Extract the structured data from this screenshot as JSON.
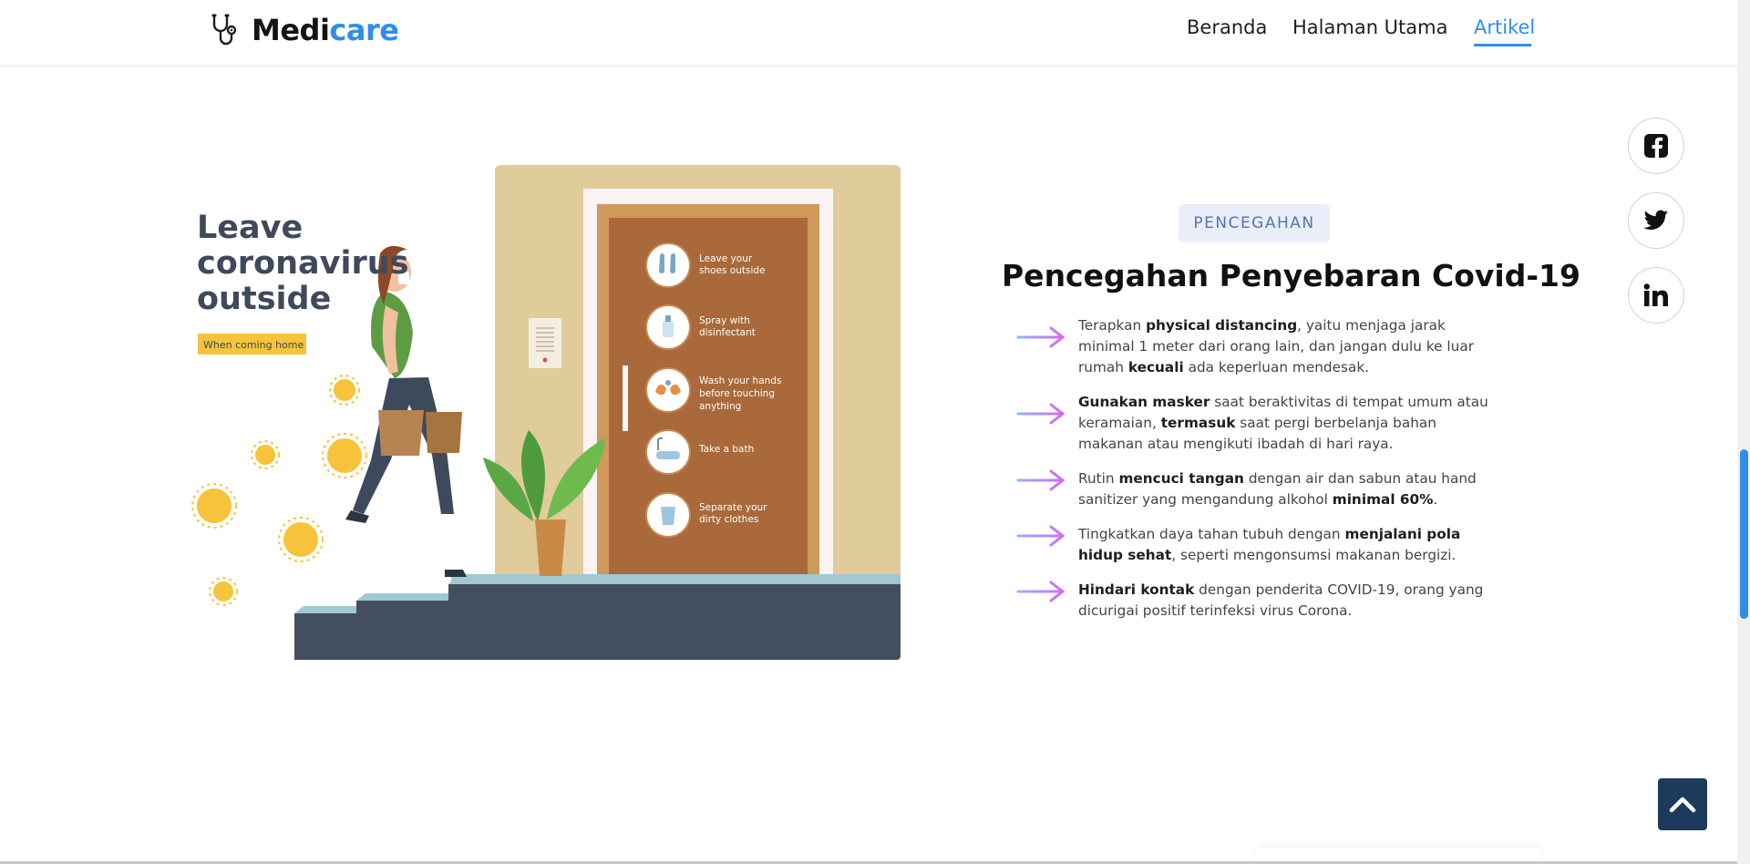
{
  "brand": {
    "part1": "Medi",
    "part2": "care"
  },
  "nav": {
    "items": [
      {
        "label": "Beranda"
      },
      {
        "label": "Halaman Utama"
      },
      {
        "label": "Artikel",
        "active": true
      }
    ]
  },
  "illustration": {
    "headline_1": "Leave",
    "headline_2": "coronavirus",
    "headline_3": "outside",
    "badge": "When coming home",
    "steps": [
      {
        "line1": "Leave your",
        "line2": "shoes outside",
        "line3": ""
      },
      {
        "line1": "Spray with",
        "line2": "disinfectant",
        "line3": ""
      },
      {
        "line1": "Wash your hands",
        "line2": "before touching",
        "line3": "anything"
      },
      {
        "line1": "Take a bath",
        "line2": "",
        "line3": ""
      },
      {
        "line1": "Separate your",
        "line2": "dirty clothes",
        "line3": ""
      }
    ]
  },
  "article": {
    "tag": "PENCEGAHAN",
    "title": "Pencegahan Penyebaran Covid-19",
    "items": [
      {
        "parts": [
          "Terapkan ",
          "physical distancing",
          ", yaitu menjaga jarak minimal 1 meter dari orang lain, dan jangan dulu ke luar rumah ",
          "kecuali",
          " ada keperluan mendesak."
        ]
      },
      {
        "parts": [
          "",
          "Gunakan masker",
          " saat beraktivitas di tempat umum atau keramaian, ",
          "termasuk",
          " saat pergi berbelanja bahan makanan atau mengikuti ibadah di hari raya."
        ]
      },
      {
        "parts": [
          "Rutin ",
          "mencuci tangan",
          " dengan air dan sabun atau hand sanitizer yang mengandung alkohol ",
          "minimal 60%",
          "."
        ]
      },
      {
        "parts": [
          "Tingkatkan daya tahan tubuh dengan ",
          "menjalani pola hidup sehat",
          ", seperti mengonsumsi makanan bergizi.",
          "",
          ""
        ]
      },
      {
        "parts": [
          "",
          "Hindari kontak",
          " dengan penderita COVID-19, orang yang dicurigai positif terinfeksi virus Corona.",
          "",
          ""
        ]
      }
    ]
  },
  "social": [
    {
      "icon": "facebook-icon"
    },
    {
      "icon": "twitter-icon"
    },
    {
      "icon": "linkedin-icon"
    }
  ],
  "colors": {
    "accent": "#2f8fe8",
    "tag_bg": "#e9eef9",
    "tag_text": "#5872b1",
    "to_top_bg": "#1b3a5c"
  }
}
